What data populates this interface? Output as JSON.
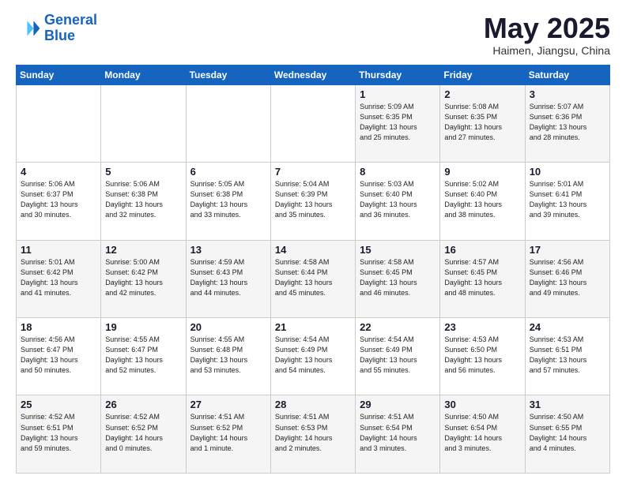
{
  "header": {
    "logo_line1": "General",
    "logo_line2": "Blue",
    "month": "May 2025",
    "location": "Haimen, Jiangsu, China"
  },
  "weekdays": [
    "Sunday",
    "Monday",
    "Tuesday",
    "Wednesday",
    "Thursday",
    "Friday",
    "Saturday"
  ],
  "weeks": [
    [
      {
        "day": "",
        "info": ""
      },
      {
        "day": "",
        "info": ""
      },
      {
        "day": "",
        "info": ""
      },
      {
        "day": "",
        "info": ""
      },
      {
        "day": "1",
        "info": "Sunrise: 5:09 AM\nSunset: 6:35 PM\nDaylight: 13 hours\nand 25 minutes."
      },
      {
        "day": "2",
        "info": "Sunrise: 5:08 AM\nSunset: 6:35 PM\nDaylight: 13 hours\nand 27 minutes."
      },
      {
        "day": "3",
        "info": "Sunrise: 5:07 AM\nSunset: 6:36 PM\nDaylight: 13 hours\nand 28 minutes."
      }
    ],
    [
      {
        "day": "4",
        "info": "Sunrise: 5:06 AM\nSunset: 6:37 PM\nDaylight: 13 hours\nand 30 minutes."
      },
      {
        "day": "5",
        "info": "Sunrise: 5:06 AM\nSunset: 6:38 PM\nDaylight: 13 hours\nand 32 minutes."
      },
      {
        "day": "6",
        "info": "Sunrise: 5:05 AM\nSunset: 6:38 PM\nDaylight: 13 hours\nand 33 minutes."
      },
      {
        "day": "7",
        "info": "Sunrise: 5:04 AM\nSunset: 6:39 PM\nDaylight: 13 hours\nand 35 minutes."
      },
      {
        "day": "8",
        "info": "Sunrise: 5:03 AM\nSunset: 6:40 PM\nDaylight: 13 hours\nand 36 minutes."
      },
      {
        "day": "9",
        "info": "Sunrise: 5:02 AM\nSunset: 6:40 PM\nDaylight: 13 hours\nand 38 minutes."
      },
      {
        "day": "10",
        "info": "Sunrise: 5:01 AM\nSunset: 6:41 PM\nDaylight: 13 hours\nand 39 minutes."
      }
    ],
    [
      {
        "day": "11",
        "info": "Sunrise: 5:01 AM\nSunset: 6:42 PM\nDaylight: 13 hours\nand 41 minutes."
      },
      {
        "day": "12",
        "info": "Sunrise: 5:00 AM\nSunset: 6:42 PM\nDaylight: 13 hours\nand 42 minutes."
      },
      {
        "day": "13",
        "info": "Sunrise: 4:59 AM\nSunset: 6:43 PM\nDaylight: 13 hours\nand 44 minutes."
      },
      {
        "day": "14",
        "info": "Sunrise: 4:58 AM\nSunset: 6:44 PM\nDaylight: 13 hours\nand 45 minutes."
      },
      {
        "day": "15",
        "info": "Sunrise: 4:58 AM\nSunset: 6:45 PM\nDaylight: 13 hours\nand 46 minutes."
      },
      {
        "day": "16",
        "info": "Sunrise: 4:57 AM\nSunset: 6:45 PM\nDaylight: 13 hours\nand 48 minutes."
      },
      {
        "day": "17",
        "info": "Sunrise: 4:56 AM\nSunset: 6:46 PM\nDaylight: 13 hours\nand 49 minutes."
      }
    ],
    [
      {
        "day": "18",
        "info": "Sunrise: 4:56 AM\nSunset: 6:47 PM\nDaylight: 13 hours\nand 50 minutes."
      },
      {
        "day": "19",
        "info": "Sunrise: 4:55 AM\nSunset: 6:47 PM\nDaylight: 13 hours\nand 52 minutes."
      },
      {
        "day": "20",
        "info": "Sunrise: 4:55 AM\nSunset: 6:48 PM\nDaylight: 13 hours\nand 53 minutes."
      },
      {
        "day": "21",
        "info": "Sunrise: 4:54 AM\nSunset: 6:49 PM\nDaylight: 13 hours\nand 54 minutes."
      },
      {
        "day": "22",
        "info": "Sunrise: 4:54 AM\nSunset: 6:49 PM\nDaylight: 13 hours\nand 55 minutes."
      },
      {
        "day": "23",
        "info": "Sunrise: 4:53 AM\nSunset: 6:50 PM\nDaylight: 13 hours\nand 56 minutes."
      },
      {
        "day": "24",
        "info": "Sunrise: 4:53 AM\nSunset: 6:51 PM\nDaylight: 13 hours\nand 57 minutes."
      }
    ],
    [
      {
        "day": "25",
        "info": "Sunrise: 4:52 AM\nSunset: 6:51 PM\nDaylight: 13 hours\nand 59 minutes."
      },
      {
        "day": "26",
        "info": "Sunrise: 4:52 AM\nSunset: 6:52 PM\nDaylight: 14 hours\nand 0 minutes."
      },
      {
        "day": "27",
        "info": "Sunrise: 4:51 AM\nSunset: 6:52 PM\nDaylight: 14 hours\nand 1 minute."
      },
      {
        "day": "28",
        "info": "Sunrise: 4:51 AM\nSunset: 6:53 PM\nDaylight: 14 hours\nand 2 minutes."
      },
      {
        "day": "29",
        "info": "Sunrise: 4:51 AM\nSunset: 6:54 PM\nDaylight: 14 hours\nand 3 minutes."
      },
      {
        "day": "30",
        "info": "Sunrise: 4:50 AM\nSunset: 6:54 PM\nDaylight: 14 hours\nand 3 minutes."
      },
      {
        "day": "31",
        "info": "Sunrise: 4:50 AM\nSunset: 6:55 PM\nDaylight: 14 hours\nand 4 minutes."
      }
    ]
  ]
}
